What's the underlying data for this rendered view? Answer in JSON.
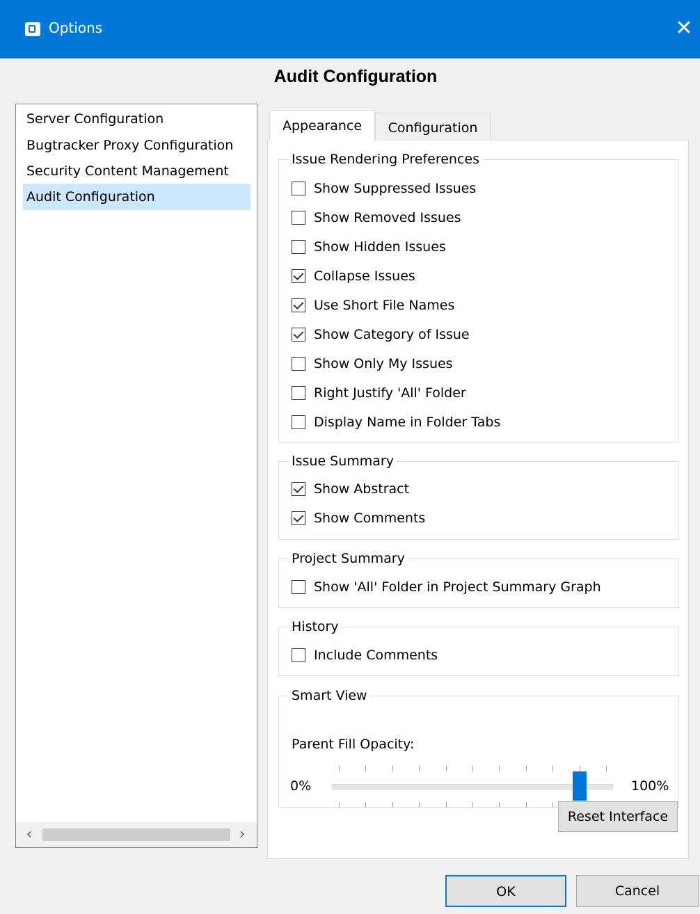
{
  "window": {
    "title": "Options",
    "app_icon": "app-icon",
    "close_icon": "close-icon"
  },
  "page": {
    "heading": "Audit Configuration"
  },
  "nav": {
    "items": [
      {
        "label": "Server Configuration",
        "selected": false
      },
      {
        "label": "Bugtracker Proxy Configuration",
        "selected": false
      },
      {
        "label": "Security Content Management",
        "selected": false
      },
      {
        "label": "Audit Configuration",
        "selected": true
      }
    ],
    "scroll_left_icon": "chevron-left-icon",
    "scroll_right_icon": "chevron-right-icon"
  },
  "tabs": [
    {
      "label": "Appearance",
      "active": true
    },
    {
      "label": "Configuration",
      "active": false
    }
  ],
  "groups": {
    "rendering": {
      "title": "Issue Rendering Preferences",
      "items": [
        {
          "label": "Show Suppressed Issues",
          "checked": false
        },
        {
          "label": "Show Removed Issues",
          "checked": false
        },
        {
          "label": "Show Hidden Issues",
          "checked": false
        },
        {
          "label": "Collapse Issues",
          "checked": true
        },
        {
          "label": "Use Short File Names",
          "checked": true
        },
        {
          "label": "Show Category of Issue",
          "checked": true
        },
        {
          "label": "Show Only My Issues",
          "checked": false
        },
        {
          "label": "Right Justify 'All' Folder",
          "checked": false
        },
        {
          "label": "Display Name in Folder Tabs",
          "checked": false
        }
      ]
    },
    "summary": {
      "title": "Issue Summary",
      "items": [
        {
          "label": "Show Abstract",
          "checked": true
        },
        {
          "label": "Show Comments",
          "checked": true
        }
      ]
    },
    "project": {
      "title": "Project Summary",
      "items": [
        {
          "label": "Show 'All' Folder in Project Summary Graph",
          "checked": false
        }
      ]
    },
    "history": {
      "title": "History",
      "items": [
        {
          "label": "Include Comments",
          "checked": false
        }
      ]
    },
    "smart_view": {
      "title": "Smart View",
      "slider_label": "Parent Fill Opacity:",
      "min_label": "0%",
      "max_label": "100%",
      "value_percent": 90,
      "tick_count": 11
    }
  },
  "buttons": {
    "reset": "Reset Interface",
    "ok": "OK",
    "cancel": "Cancel"
  },
  "colors": {
    "accent": "#0078d7",
    "selection": "#cce8ff"
  }
}
